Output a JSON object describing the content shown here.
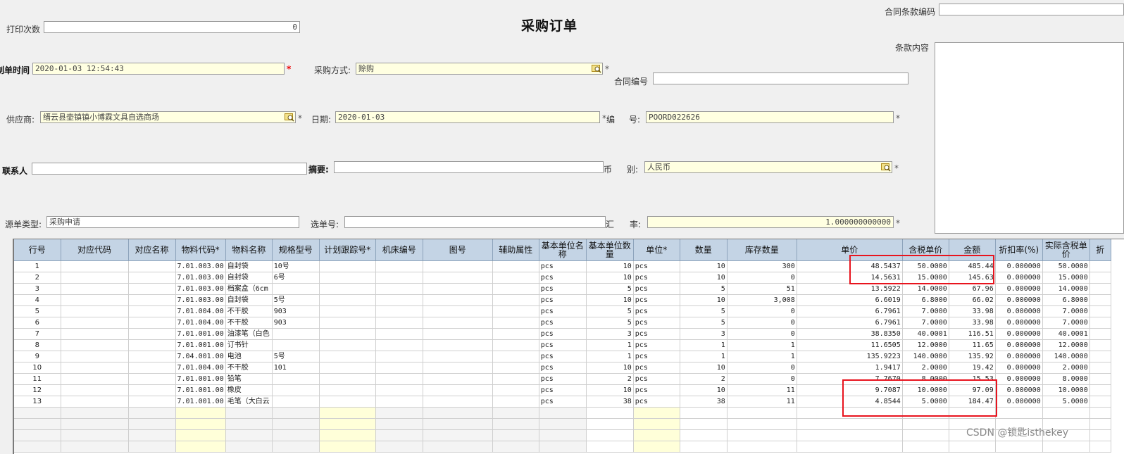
{
  "form": {
    "title": "采购订单",
    "print_count_label": "打印次数",
    "print_count_value": "0",
    "contract_code_label": "合同条款编码",
    "contract_code_value": "",
    "terms_label": "条款内容",
    "create_time_label": "制单时间",
    "create_time_value": "2020-01-03 12:54:43",
    "purchase_method_label": "采购方式:",
    "purchase_method_value": "赊购",
    "contract_no_label": "合同编号",
    "contract_no_value": "",
    "supplier_label": "供应商:",
    "supplier_value": "缙云县壶镇镇小博霖文具自选商场",
    "date_label": "日期:",
    "date_value": "2020-01-03",
    "number_label_a": "编",
    "number_label_b": "号:",
    "number_value": "POORD022626",
    "contact_label": "联系人",
    "contact_value": "",
    "summary_label": "摘要:",
    "summary_value": "",
    "currency_label_a": "币",
    "currency_label_b": "别:",
    "currency_value": "人民币",
    "source_type_label": "源单类型:",
    "source_type_value": "采购申请",
    "select_no_label": "选单号:",
    "select_no_value": "",
    "rate_label_a": "汇",
    "rate_label_b": "率:",
    "rate_value": "1.000000000000",
    "required_mark": "*"
  },
  "table": {
    "headers": [
      "行号",
      "对应代码",
      "对应名称",
      "物料代码*",
      "物料名称",
      "规格型号",
      "计划跟踪号*",
      "机床编号",
      "图号",
      "辅助属性",
      "基本单位名称",
      "基本单位数量",
      "单位*",
      "数量",
      "库存数量",
      "单价",
      "含税单价",
      "金额",
      "折扣率(%)",
      "实际含税单价",
      "折"
    ],
    "rows": [
      [
        "1",
        "",
        "",
        "7.01.003.00",
        "自封袋",
        "10号",
        "",
        "",
        "",
        "",
        "pcs",
        "10",
        "pcs",
        "10",
        "300",
        "48.5437",
        "50.0000",
        "485.44",
        "0.000000",
        "50.0000",
        ""
      ],
      [
        "2",
        "",
        "",
        "7.01.003.00",
        "自封袋",
        "6号",
        "",
        "",
        "",
        "",
        "pcs",
        "10",
        "pcs",
        "10",
        "0",
        "14.5631",
        "15.0000",
        "145.63",
        "0.000000",
        "15.0000",
        ""
      ],
      [
        "3",
        "",
        "",
        "7.01.003.00",
        "档案盒（6cm",
        "",
        "",
        "",
        "",
        "",
        "pcs",
        "5",
        "pcs",
        "5",
        "51",
        "13.5922",
        "14.0000",
        "67.96",
        "0.000000",
        "14.0000",
        ""
      ],
      [
        "4",
        "",
        "",
        "7.01.003.00",
        "自封袋",
        "5号",
        "",
        "",
        "",
        "",
        "pcs",
        "10",
        "pcs",
        "10",
        "3,008",
        "6.6019",
        "6.8000",
        "66.02",
        "0.000000",
        "6.8000",
        ""
      ],
      [
        "5",
        "",
        "",
        "7.01.004.00",
        "不干胶",
        "903",
        "",
        "",
        "",
        "",
        "pcs",
        "5",
        "pcs",
        "5",
        "0",
        "6.7961",
        "7.0000",
        "33.98",
        "0.000000",
        "7.0000",
        ""
      ],
      [
        "6",
        "",
        "",
        "7.01.004.00",
        "不干胶",
        "903",
        "",
        "",
        "",
        "",
        "pcs",
        "5",
        "pcs",
        "5",
        "0",
        "6.7961",
        "7.0000",
        "33.98",
        "0.000000",
        "7.0000",
        ""
      ],
      [
        "7",
        "",
        "",
        "7.01.001.00",
        "油漆笔（白色",
        "",
        "",
        "",
        "",
        "",
        "pcs",
        "3",
        "pcs",
        "3",
        "0",
        "38.8350",
        "40.0001",
        "116.51",
        "0.000000",
        "40.0001",
        ""
      ],
      [
        "8",
        "",
        "",
        "7.01.001.00",
        "订书针",
        "",
        "",
        "",
        "",
        "",
        "pcs",
        "1",
        "pcs",
        "1",
        "1",
        "11.6505",
        "12.0000",
        "11.65",
        "0.000000",
        "12.0000",
        ""
      ],
      [
        "9",
        "",
        "",
        "7.04.001.00",
        "电池",
        "5号",
        "",
        "",
        "",
        "",
        "pcs",
        "1",
        "pcs",
        "1",
        "1",
        "135.9223",
        "140.0000",
        "135.92",
        "0.000000",
        "140.0000",
        ""
      ],
      [
        "10",
        "",
        "",
        "7.01.004.00",
        "不干胶",
        "101",
        "",
        "",
        "",
        "",
        "pcs",
        "10",
        "pcs",
        "10",
        "0",
        "1.9417",
        "2.0000",
        "19.42",
        "0.000000",
        "2.0000",
        ""
      ],
      [
        "11",
        "",
        "",
        "7.01.001.00",
        "铅笔",
        "",
        "",
        "",
        "",
        "",
        "pcs",
        "2",
        "pcs",
        "2",
        "0",
        "7.7670",
        "8.0000",
        "15.53",
        "0.000000",
        "8.0000",
        ""
      ],
      [
        "12",
        "",
        "",
        "7.01.001.00",
        "橡皮",
        "",
        "",
        "",
        "",
        "",
        "pcs",
        "10",
        "pcs",
        "10",
        "11",
        "9.7087",
        "10.0000",
        "97.09",
        "0.000000",
        "10.0000",
        ""
      ],
      [
        "13",
        "",
        "",
        "7.01.001.00",
        "毛笔（大白云",
        "",
        "",
        "",
        "",
        "",
        "pcs",
        "38",
        "pcs",
        "38",
        "11",
        "4.8544",
        "5.0000",
        "184.47",
        "0.000000",
        "5.0000",
        ""
      ]
    ],
    "empty_rows": 4
  },
  "watermark": "CSDN @锁匙isthekey"
}
